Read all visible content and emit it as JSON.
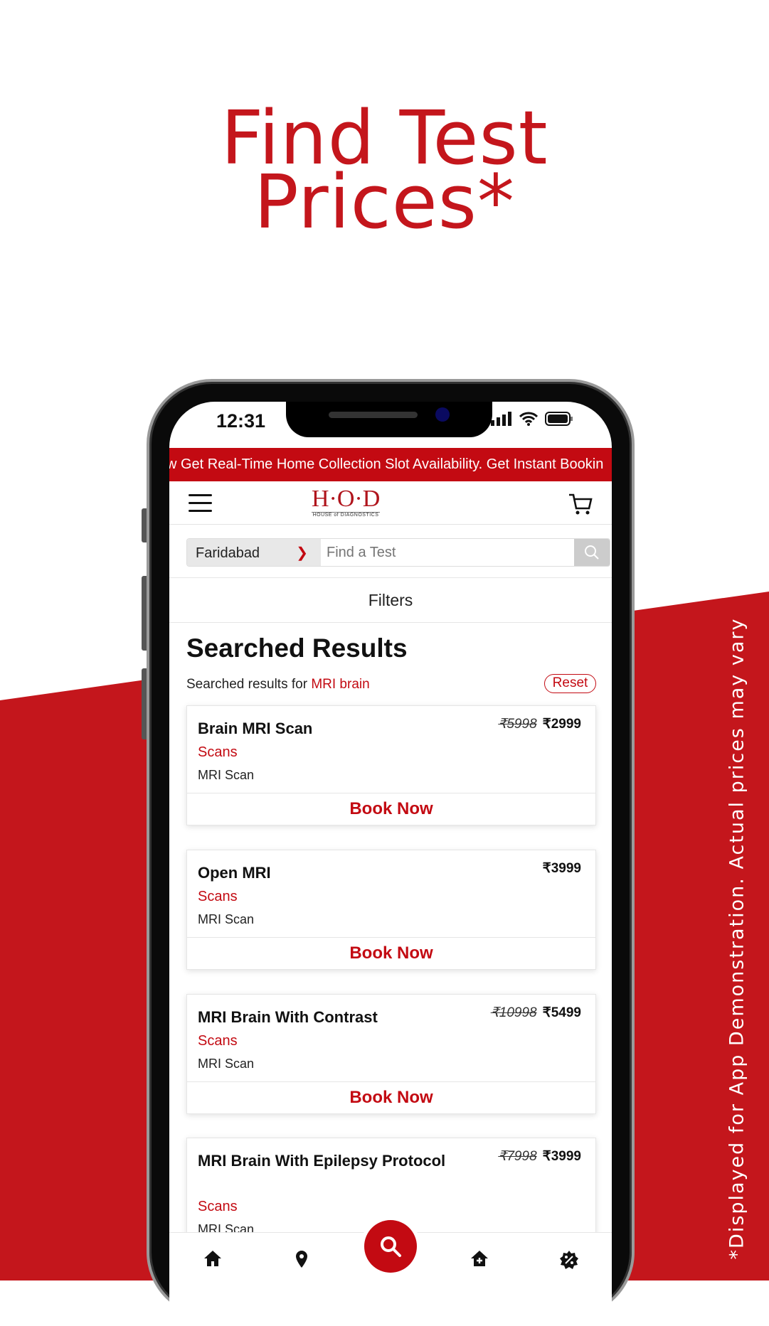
{
  "hero": {
    "title_line1": "Find Test",
    "title_line2": "Prices*",
    "disclaimer": "*Displayed for App Demonstration. Actual prices may vary"
  },
  "colors": {
    "brand": "#c4161c"
  },
  "status_bar": {
    "time": "12:31",
    "icons": [
      "signal-icon",
      "wifi-icon",
      "battery-icon"
    ]
  },
  "banner": {
    "text": "w Get Real-Time Home Collection Slot Availability. Get Instant Bookin"
  },
  "header": {
    "logo_main": "H·O·D",
    "logo_sub": "HOUSE of DIAGNOSTICS"
  },
  "search": {
    "city": "Faridabad",
    "placeholder": "Find a Test"
  },
  "filters_label": "Filters",
  "results": {
    "heading": "Searched Results",
    "prefix": "Searched results for ",
    "query": "MRI brain",
    "reset_label": "Reset"
  },
  "cards": [
    {
      "name": "Brain MRI Scan",
      "old_price": "₹5998",
      "price": "₹2999",
      "category": "Scans",
      "type": "MRI Scan",
      "cta": "Book Now"
    },
    {
      "name": "Open MRI",
      "old_price": "",
      "price": "₹3999",
      "category": "Scans",
      "type": "MRI Scan",
      "cta": "Book Now"
    },
    {
      "name": "MRI Brain With Contrast",
      "old_price": "₹10998",
      "price": "₹5499",
      "category": "Scans",
      "type": "MRI Scan",
      "cta": "Book Now"
    },
    {
      "name": "MRI Brain With Epilepsy Protocol",
      "old_price": "₹7998",
      "price": "₹3999",
      "category": "Scans",
      "type": "MRI Scan"
    }
  ],
  "bottom_nav": [
    "home-icon",
    "location-icon",
    "search-icon",
    "home-care-icon",
    "offers-icon"
  ]
}
